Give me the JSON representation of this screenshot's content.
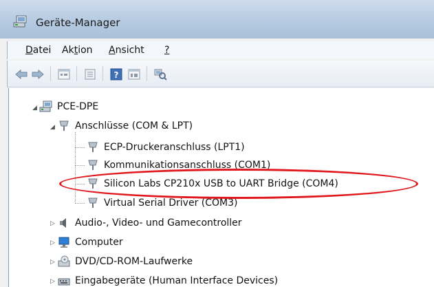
{
  "window": {
    "title": "Geräte-Manager",
    "icon": "device-manager-icon"
  },
  "menu": [
    {
      "pre": "",
      "acc": "D",
      "post": "atei"
    },
    {
      "pre": "Ak",
      "acc": "t",
      "post": "ion"
    },
    {
      "pre": "",
      "acc": "A",
      "post": "nsicht"
    },
    {
      "pre": "",
      "acc": "?",
      "post": ""
    }
  ],
  "toolbar": [
    "back-arrow-icon",
    "forward-arrow-icon",
    "show-hide-tree-icon",
    "properties-icon",
    "help-icon",
    "view-icon",
    "scan-hardware-icon"
  ],
  "tree": {
    "root": "PCE-DPE",
    "ports_group": "Anschlüsse (COM & LPT)",
    "ports": [
      "ECP-Druckeranschluss (LPT1)",
      "Kommunikationsanschluss (COM1)",
      "Silicon Labs CP210x USB to UART Bridge (COM4)",
      "Virtual Serial Driver (COM3)"
    ],
    "other_groups": [
      "Audio-, Video- und Gamecontroller",
      "Computer",
      "DVD/CD-ROM-Laufwerke",
      "Eingabegeräte (Human Interface Devices)"
    ]
  },
  "colors": {
    "highlight": "#e0191e",
    "titlebar": "#b9cde3"
  }
}
